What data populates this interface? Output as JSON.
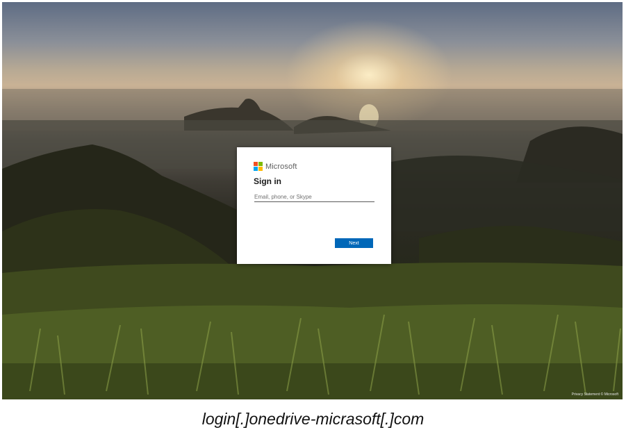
{
  "page": {
    "brand_name": "Microsoft",
    "brand_colors": [
      "#f25022",
      "#7fba00",
      "#00a4ef",
      "#ffb900"
    ],
    "title": "Sign in",
    "input": {
      "placeholder": "Email, phone, or Skype",
      "value": ""
    },
    "next_button": "Next",
    "footer": "Privacy Statement © Microsoft",
    "accent_color": "#0067b8"
  },
  "caption": "login[.]onedrive-micrasoft[.]com"
}
